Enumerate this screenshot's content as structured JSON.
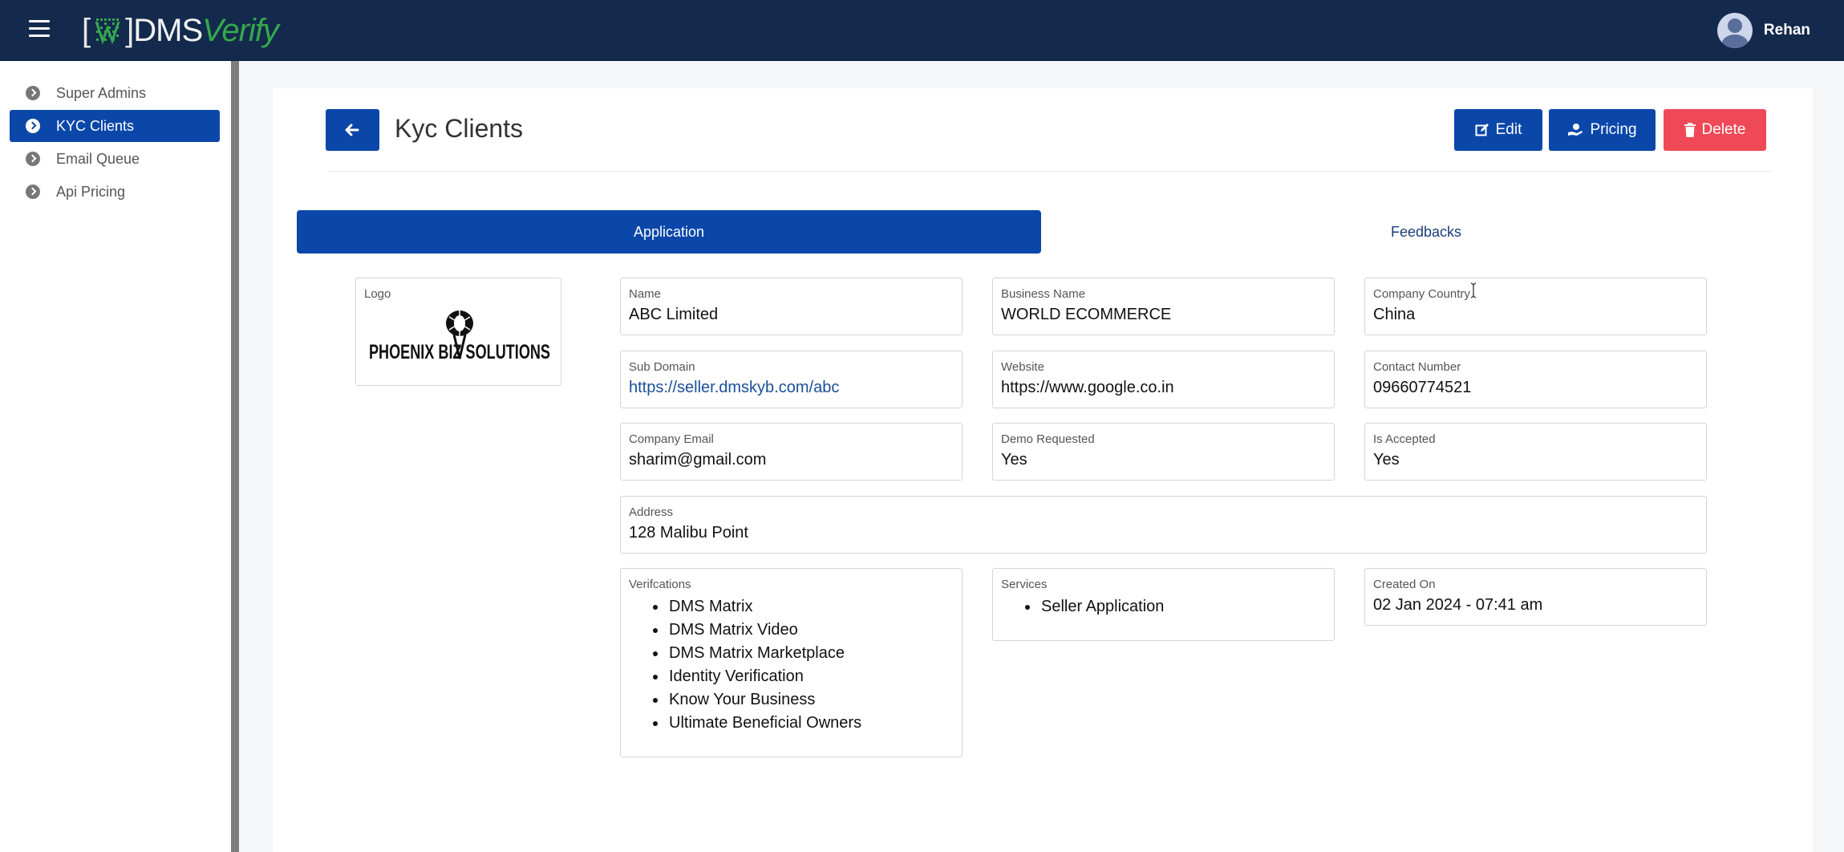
{
  "topbar": {
    "brand_bracket_open": "[",
    "brand_bracket_close": "]",
    "brand_dms": "DMS",
    "brand_verify": "Verify",
    "user_name": "Rehan"
  },
  "sidebar": {
    "items": [
      {
        "label": "Super Admins"
      },
      {
        "label": "KYC Clients"
      },
      {
        "label": "Email Queue"
      },
      {
        "label": "Api Pricing"
      }
    ]
  },
  "page": {
    "title": "Kyc Clients",
    "buttons": {
      "edit": "Edit",
      "pricing": "Pricing",
      "delete": "Delete"
    },
    "tabs": {
      "application": "Application",
      "feedbacks": "Feedbacks"
    }
  },
  "details": {
    "logo_label": "Logo",
    "logo_text": "PHOENIX BIZ SOLUTIONS",
    "name_label": "Name",
    "name": "ABC Limited",
    "business_name_label": "Business Name",
    "business_name": "WORLD ECOMMERCE",
    "company_country_label": "Company Country",
    "company_country": "China",
    "sub_domain_label": "Sub Domain",
    "sub_domain": "https://seller.dmskyb.com/abc",
    "website_label": "Website",
    "website": "https://www.google.co.in",
    "contact_number_label": "Contact Number",
    "contact_number": "09660774521",
    "company_email_label": "Company Email",
    "company_email": "sharim@gmail.com",
    "demo_requested_label": "Demo Requested",
    "demo_requested": "Yes",
    "is_accepted_label": "Is Accepted",
    "is_accepted": "Yes",
    "address_label": "Address",
    "address": "128 Malibu Point",
    "verifications_label": "Verifcations",
    "verifications": [
      "DMS Matrix",
      "DMS Matrix Video",
      "DMS Matrix Marketplace",
      "Identity Verification",
      "Know Your Business",
      "Ultimate Beneficial Owners"
    ],
    "services_label": "Services",
    "services": [
      "Seller Application"
    ],
    "created_on_label": "Created On",
    "created_on": "02 Jan 2024 - 07:41 am"
  },
  "colors": {
    "topbar": "#142a4c",
    "primary": "#0a47a9",
    "danger": "#ef4957",
    "brand_green": "#35a84e"
  }
}
